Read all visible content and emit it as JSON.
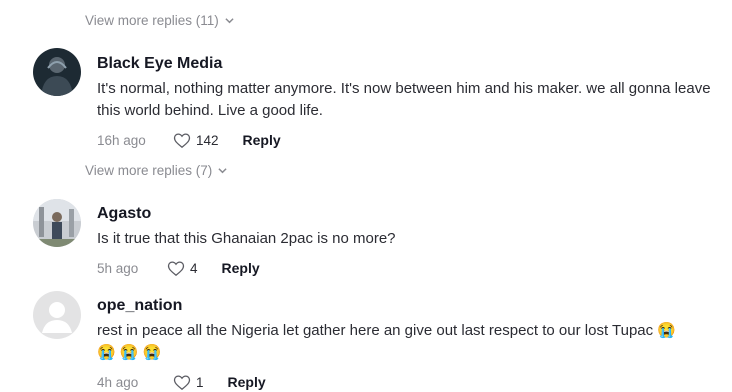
{
  "thread": {
    "view_more_1": "View more replies (11)",
    "view_more_2": "View more replies (7)"
  },
  "comments": [
    {
      "username": "Black Eye Media",
      "text": "It's normal, nothing matter anymore. It's now between him and his maker. we all gonna leave this world behind. Live a good life.",
      "time": "16h ago",
      "likes": "142",
      "reply_label": "Reply"
    },
    {
      "username": "Agasto",
      "text": "Is it true that this Ghanaian 2pac is no more?",
      "time": "5h ago",
      "likes": "4",
      "reply_label": "Reply"
    },
    {
      "username": "ope_nation",
      "text": "rest in peace all the Nigeria let gather here an give out last respect to our lost Tupac",
      "emoji": "😭",
      "emoji_line": "😭 😭 😭",
      "time": "4h ago",
      "likes": "1",
      "reply_label": "Reply"
    }
  ],
  "colors": {
    "text_primary": "#161823",
    "text_secondary": "#8a8b91"
  }
}
